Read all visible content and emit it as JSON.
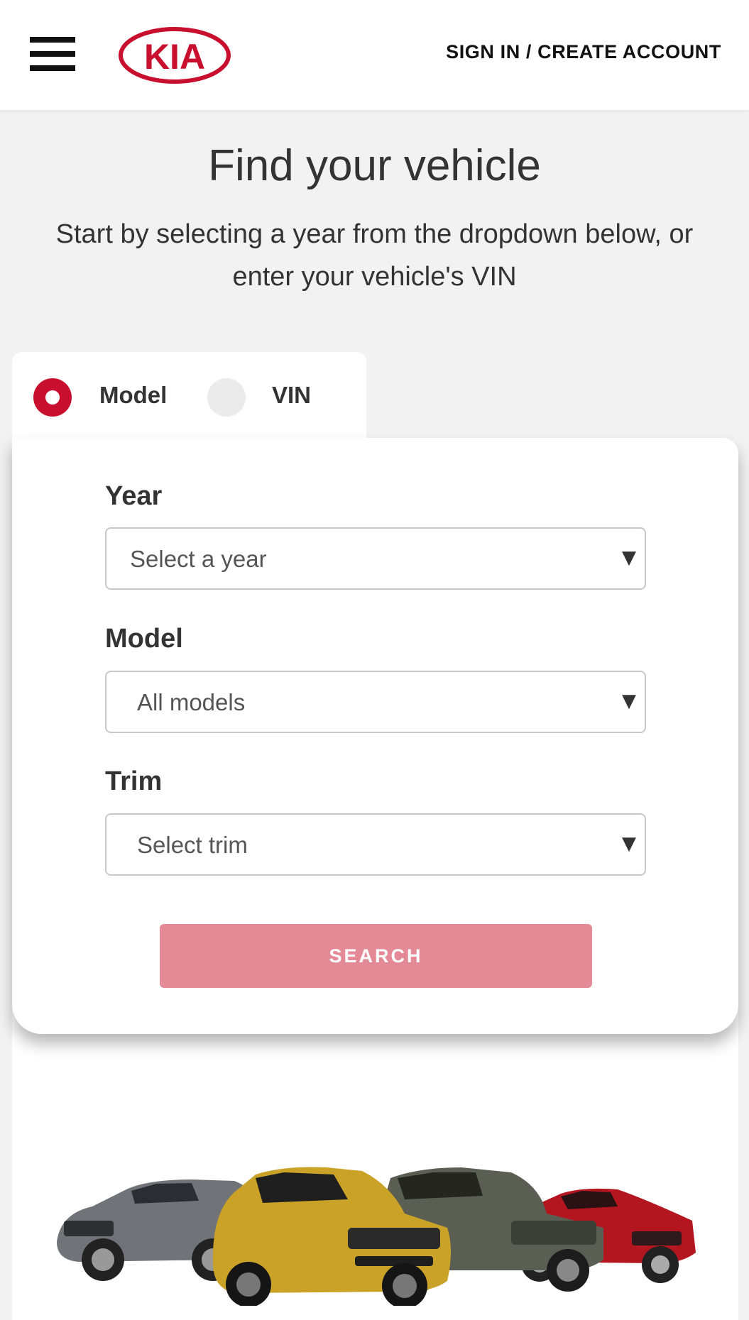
{
  "header": {
    "brand": "KIA",
    "signin_label": "SIGN IN / CREATE ACCOUNT"
  },
  "page": {
    "title": "Find your vehicle",
    "subtitle": "Start by selecting a year from the dropdown below, or enter your vehicle's VIN"
  },
  "tabs": {
    "model_label": "Model",
    "vin_label": "VIN",
    "selected": "Model"
  },
  "form": {
    "year": {
      "label": "Year",
      "value": "Select a year"
    },
    "model": {
      "label": "Model",
      "value": "All models"
    },
    "trim": {
      "label": "Trim",
      "value": "Select trim"
    },
    "search_label": "SEARCH"
  },
  "colors": {
    "brand": "#c8102e",
    "search_button": "#e38a96",
    "background": "#f2f2f2"
  },
  "icons": [
    "hamburger-menu-icon",
    "kia-logo",
    "chevron-down-icon"
  ]
}
